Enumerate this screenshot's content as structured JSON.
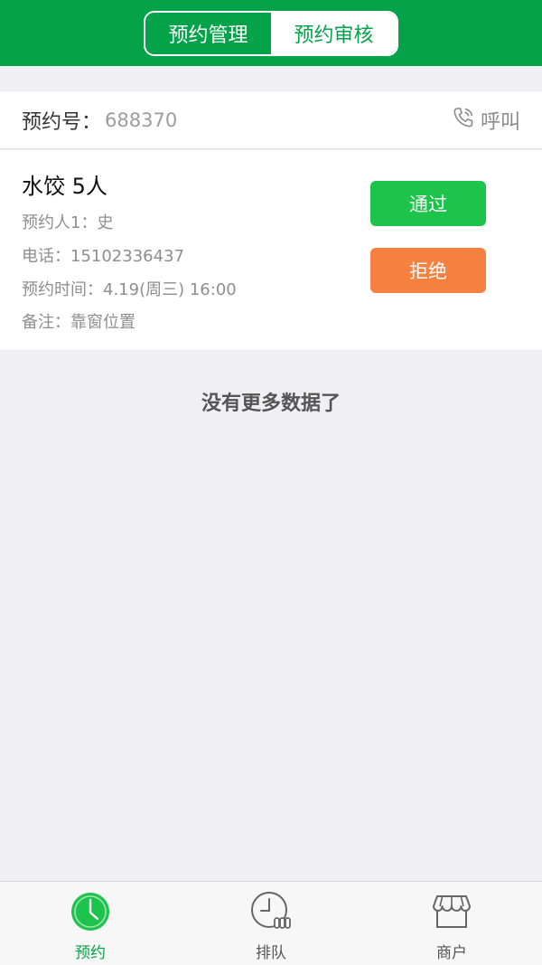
{
  "header": {
    "tabs": [
      {
        "label": "预约管理",
        "active": false
      },
      {
        "label": "预约审核",
        "active": true
      }
    ],
    "colors": {
      "primary": "#04a349"
    }
  },
  "booking": {
    "number_label": "预约号：",
    "number": "688370",
    "call_label": "呼叫",
    "call_icon": "phone-icon"
  },
  "card": {
    "title": "水饺  5人",
    "booker": "预约人1：史",
    "phone": "电话：15102336437",
    "time": "预约时间：4.19(周三) 16:00",
    "note": "备注：靠窗位置",
    "approve_label": "通过",
    "reject_label": "拒绝",
    "colors": {
      "approve": "#1ec34c",
      "reject": "#f6803f"
    }
  },
  "list": {
    "end_text": "没有更多数据了"
  },
  "tabbar": {
    "items": [
      {
        "label": "预约",
        "icon": "clock-icon",
        "selected": true
      },
      {
        "label": "排队",
        "icon": "queue-icon",
        "selected": false
      },
      {
        "label": "商户",
        "icon": "store-icon",
        "selected": false
      }
    ]
  }
}
